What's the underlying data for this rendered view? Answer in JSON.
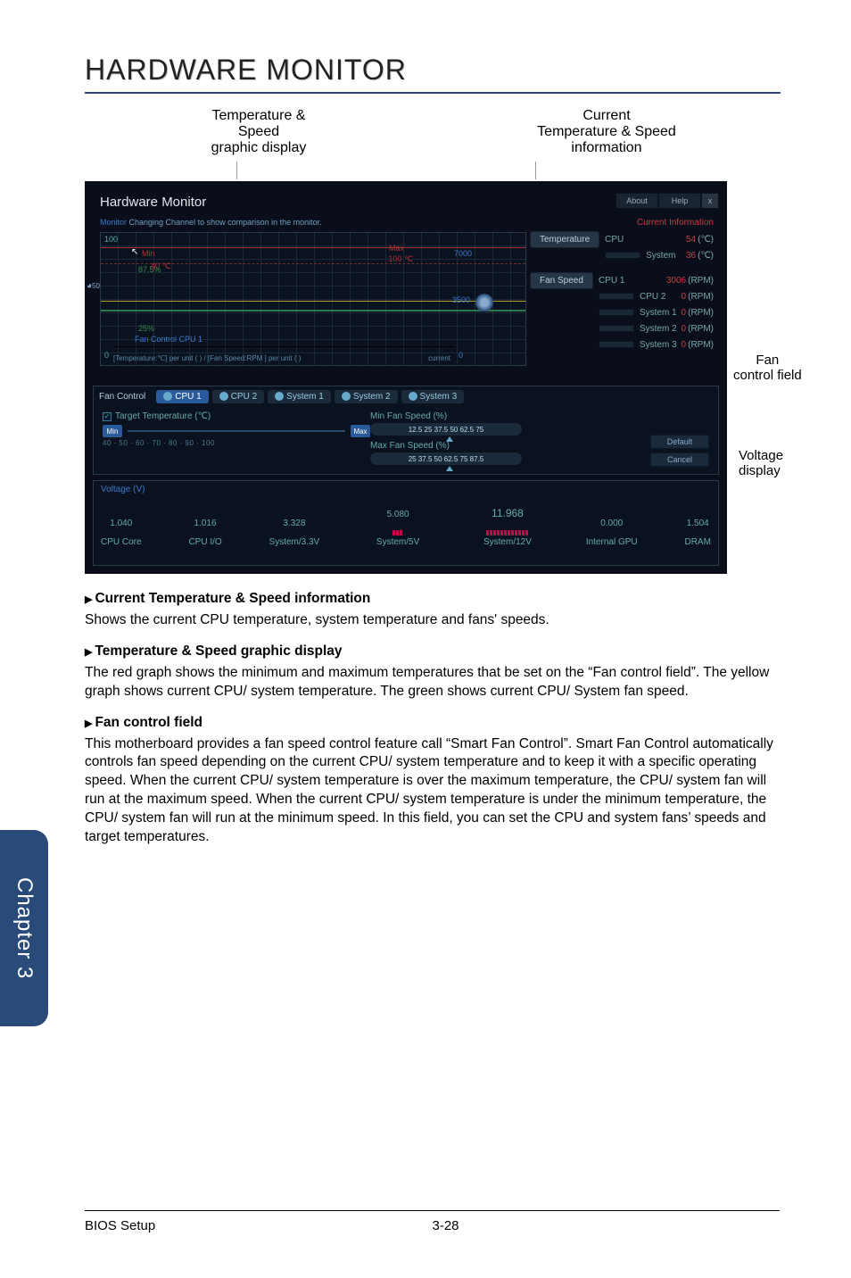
{
  "page": {
    "title": "HARDWARE MONITOR",
    "chapter_tab": "Chapter 3",
    "footer_left": "BIOS Setup",
    "footer_page": "3-28"
  },
  "callouts": {
    "left_col_l1": "Temperature &",
    "left_col_l2": "Speed",
    "left_col_l3": "graphic display",
    "right_col_l1": "Current",
    "right_col_l2": "Temperature & Speed",
    "right_col_l3": "information",
    "side_fan_l1": "Fan",
    "side_fan_l2": "control field",
    "side_voltage_l1": "Voltage",
    "side_voltage_l2": "display"
  },
  "hwmon": {
    "window_title": "Hardware Monitor",
    "about": "About",
    "help": "Help",
    "close": "x",
    "monitor_label": "Monitor",
    "monitor_note": " Changing Channel to show comparison in the monitor.",
    "graph": {
      "y100": "100",
      "y0": "0",
      "min": "Min",
      "min_temp": "40 ℃",
      "max": "Max",
      "max_temp": "100 ℃",
      "pct87": "87.5%",
      "pct25": "25%",
      "fan_cpu": "Fan Control CPU 1",
      "footer": "[Temperature:℃] per unit (    )  /  [Fan Speed:RPM ] per unit (    )",
      "current": "current",
      "r7000": "7000",
      "r3500": "3500",
      "r0": "0",
      "gauge50": "50"
    },
    "current_info": {
      "header": "Current Information",
      "temp_pill": "Temperature",
      "rows_temp": [
        {
          "label": "CPU",
          "value": "54",
          "unit": "(℃)"
        },
        {
          "label": "System",
          "value": "36",
          "unit": "(℃)"
        }
      ],
      "fan_pill": "Fan Speed",
      "rows_fan": [
        {
          "label": "CPU 1",
          "value": "3006",
          "unit": "(RPM)"
        },
        {
          "label": "CPU 2",
          "value": "0",
          "unit": "(RPM)"
        },
        {
          "label": "System 1",
          "value": "0",
          "unit": "(RPM)"
        },
        {
          "label": "System 2",
          "value": "0",
          "unit": "(RPM)"
        },
        {
          "label": "System 3",
          "value": "0",
          "unit": "(RPM)"
        }
      ]
    },
    "fan_control": {
      "label": "Fan Control",
      "tabs": [
        "CPU 1",
        "CPU 2",
        "System 1",
        "System 2",
        "System 3"
      ],
      "target_temp": "Target Temperature (℃)",
      "min_btn": "Min",
      "max_btn": "Max",
      "temp_ticks": "40    ·    50    ·    60    ·    70    ·    80    ·    90    ·    100",
      "min_fan": "Min Fan Speed (%)",
      "min_fan_scale": "12.5   25   37.5   50   62.5   75",
      "max_fan": "Max Fan Speed (%)",
      "max_fan_scale": "25   37.5   50   62.5   75   87.5",
      "default_btn": "Default",
      "cancel_btn": "Cancel"
    },
    "voltage": {
      "header": "Voltage (V)",
      "cells": [
        {
          "value": "1.040",
          "label": "CPU Core"
        },
        {
          "value": "1.016",
          "label": "CPU I/O"
        },
        {
          "value": "3.328",
          "label": "System/3.3V"
        },
        {
          "value": "5.080",
          "label": "System/5V"
        },
        {
          "value": "11.968",
          "label": "System/12V"
        },
        {
          "value": "0.000",
          "label": "Internal GPU"
        },
        {
          "value": "1.504",
          "label": "DRAM"
        }
      ]
    }
  },
  "body": {
    "h1": "Current Temperature & Speed information",
    "p1": "Shows the current CPU temperature, system temperature and fans' speeds.",
    "h2": "Temperature & Speed graphic display",
    "p2": "The red graph shows the minimum and maximum temperatures that be set on the “Fan control field”.  The yellow graph shows current CPU/ system temperature. The green shows current CPU/ System fan speed.",
    "h3": "Fan control field",
    "p3": "This motherboard provides a fan speed control feature call “Smart Fan Control”. Smart Fan Control automatically controls fan speed depending on the current CPU/ system temperature and to keep it with a specific operating speed. When the current CPU/ system temperature is over the maximum temperature, the CPU/ system fan will run at the maximum speed. When the current CPU/ system temperature is under the minimum temperature, the CPU/ system fan will run at the minimum speed. In this field, you can set the CPU and system fans’ speeds and target temperatures."
  }
}
